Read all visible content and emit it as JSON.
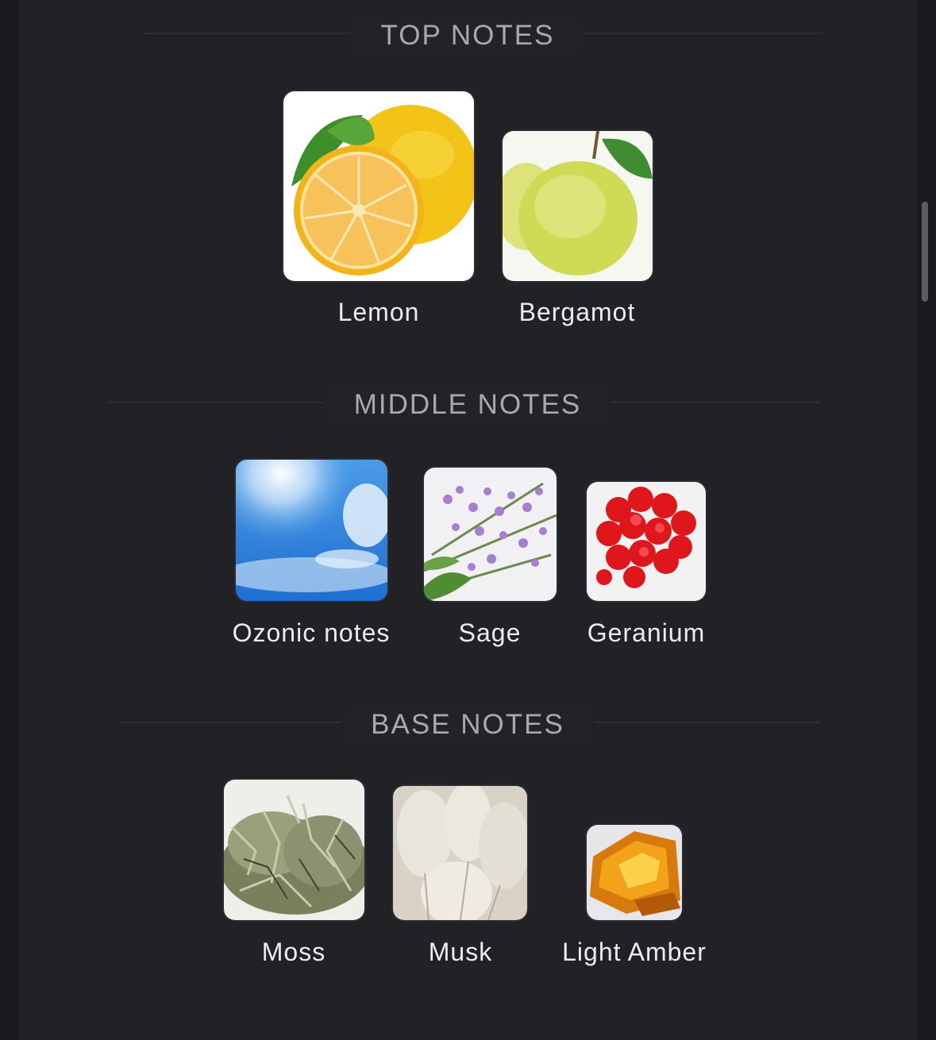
{
  "sections": {
    "top": {
      "title": "TOP NOTES",
      "notes": [
        {
          "label": "Lemon",
          "icon": "lemon-image"
        },
        {
          "label": "Bergamot",
          "icon": "bergamot-image"
        }
      ]
    },
    "middle": {
      "title": "MIDDLE NOTES",
      "notes": [
        {
          "label": "Ozonic notes",
          "icon": "sky-image"
        },
        {
          "label": "Sage",
          "icon": "sage-image"
        },
        {
          "label": "Geranium",
          "icon": "geranium-image"
        }
      ]
    },
    "base": {
      "title": "BASE NOTES",
      "notes": [
        {
          "label": "Moss",
          "icon": "moss-image"
        },
        {
          "label": "Musk",
          "icon": "musk-image"
        },
        {
          "label": "Light Amber",
          "icon": "amber-image"
        }
      ]
    }
  }
}
